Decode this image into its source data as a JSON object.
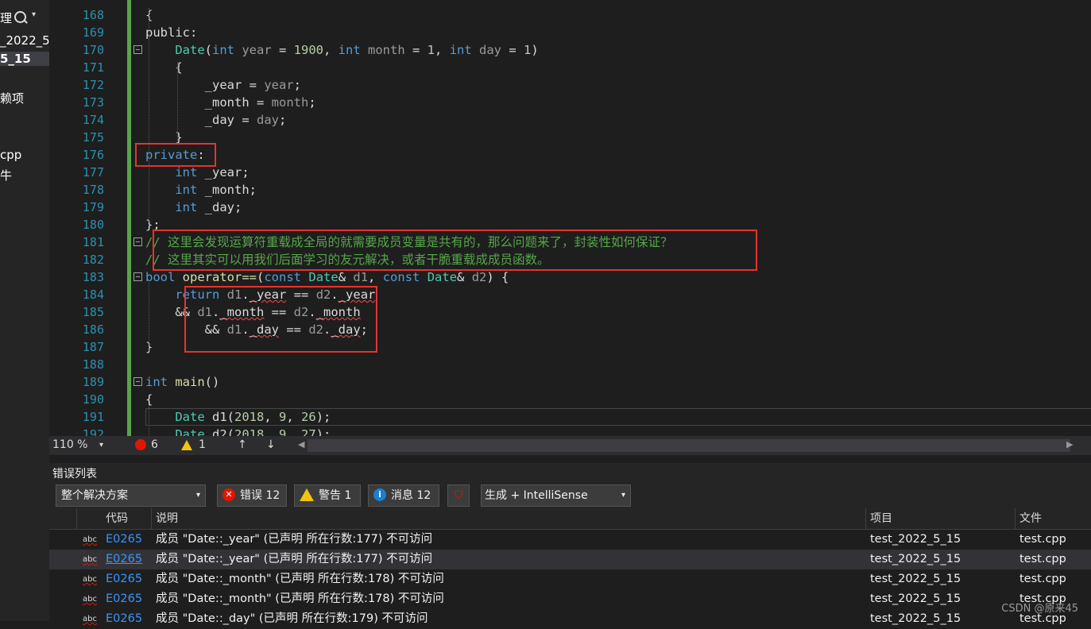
{
  "solution_explorer": {
    "items": [
      "理",
      "_2022_5",
      "5_15",
      "赖项",
      "cpp",
      "牛"
    ]
  },
  "editor": {
    "lines": [
      {
        "n": "168",
        "t": [
          [
            "{",
            ""
          ]
        ]
      },
      {
        "n": "169",
        "t": [
          [
            "public",
            ""
          ],
          [
            ":",
            ""
          ]
        ]
      },
      {
        "n": "170",
        "t": [
          [
            "    ",
            ""
          ],
          [
            "Date",
            "ty"
          ],
          [
            "(",
            ""
          ],
          [
            "int",
            "kw"
          ],
          [
            " year",
            "pa"
          ],
          [
            " = ",
            ""
          ],
          [
            "1900",
            "nm"
          ],
          [
            ", ",
            ""
          ],
          [
            "int",
            "kw"
          ],
          [
            " month",
            "pa"
          ],
          [
            " = ",
            ""
          ],
          [
            "1",
            "nm"
          ],
          [
            ", ",
            ""
          ],
          [
            "int",
            "kw"
          ],
          [
            " day",
            "pa"
          ],
          [
            " = ",
            ""
          ],
          [
            "1",
            "nm"
          ],
          [
            ")",
            ""
          ]
        ]
      },
      {
        "n": "171",
        "t": [
          [
            "    {",
            ""
          ]
        ]
      },
      {
        "n": "172",
        "t": [
          [
            "        _year",
            "me"
          ],
          [
            " = ",
            ""
          ],
          [
            "year",
            "pa"
          ],
          [
            ";",
            ""
          ]
        ]
      },
      {
        "n": "173",
        "t": [
          [
            "        _month",
            "me"
          ],
          [
            " = ",
            ""
          ],
          [
            "month",
            "pa"
          ],
          [
            ";",
            ""
          ]
        ]
      },
      {
        "n": "174",
        "t": [
          [
            "        _day",
            "me"
          ],
          [
            " = ",
            ""
          ],
          [
            "day",
            "pa"
          ],
          [
            ";",
            ""
          ]
        ]
      },
      {
        "n": "175",
        "t": [
          [
            "    }",
            ""
          ]
        ]
      },
      {
        "n": "176",
        "t": [
          [
            "private",
            "kw"
          ],
          [
            ":",
            ""
          ]
        ]
      },
      {
        "n": "177",
        "t": [
          [
            "    ",
            ""
          ],
          [
            "int",
            "kw"
          ],
          [
            " _year",
            "me"
          ],
          [
            ";",
            ""
          ]
        ]
      },
      {
        "n": "178",
        "t": [
          [
            "    ",
            ""
          ],
          [
            "int",
            "kw"
          ],
          [
            " _month",
            "me"
          ],
          [
            ";",
            ""
          ]
        ]
      },
      {
        "n": "179",
        "t": [
          [
            "    ",
            ""
          ],
          [
            "int",
            "kw"
          ],
          [
            " _day",
            "me"
          ],
          [
            ";",
            ""
          ]
        ]
      },
      {
        "n": "180",
        "t": [
          [
            "};",
            ""
          ]
        ]
      },
      {
        "n": "181",
        "t": [
          [
            "// 这里会发现运算符重载成全局的就需要成员变量是共有的，那么问题来了，封装性如何保证？",
            "cm"
          ]
        ]
      },
      {
        "n": "182",
        "t": [
          [
            "// 这里其实可以用我们后面学习的友元解决，或者干脆重载成成员函数。",
            "cm"
          ]
        ]
      },
      {
        "n": "183",
        "t": [
          [
            "bool",
            "kw"
          ],
          [
            " ",
            ""
          ],
          [
            "operator==",
            "fn"
          ],
          [
            "(",
            ""
          ],
          [
            "const",
            "kw"
          ],
          [
            " ",
            ""
          ],
          [
            "Date",
            "ty"
          ],
          [
            "& ",
            ""
          ],
          [
            "d1",
            "pa"
          ],
          [
            ", ",
            ""
          ],
          [
            "const",
            "kw"
          ],
          [
            " ",
            ""
          ],
          [
            "Date",
            "ty"
          ],
          [
            "& ",
            ""
          ],
          [
            "d2",
            "pa"
          ],
          [
            ") {",
            ""
          ]
        ]
      },
      {
        "n": "184",
        "t": [
          [
            "    ",
            ""
          ],
          [
            "return",
            "kw"
          ],
          [
            " ",
            ""
          ],
          [
            "d1",
            "pa"
          ],
          [
            ".",
            ""
          ],
          [
            "_year",
            "sq"
          ],
          [
            " == ",
            ""
          ],
          [
            "d2",
            "pa"
          ],
          [
            ".",
            ""
          ],
          [
            "_year",
            "sq"
          ]
        ]
      },
      {
        "n": "185",
        "t": [
          [
            "    && ",
            ""
          ],
          [
            "d1",
            "pa"
          ],
          [
            ".",
            ""
          ],
          [
            "_month",
            "sq"
          ],
          [
            " == ",
            ""
          ],
          [
            "d2",
            "pa"
          ],
          [
            ".",
            ""
          ],
          [
            "_month",
            "sq"
          ]
        ]
      },
      {
        "n": "186",
        "t": [
          [
            "        && ",
            ""
          ],
          [
            "d1",
            "pa"
          ],
          [
            ".",
            ""
          ],
          [
            "_day",
            "sq"
          ],
          [
            " == ",
            ""
          ],
          [
            "d2",
            "pa"
          ],
          [
            ".",
            ""
          ],
          [
            "_day",
            "sq"
          ],
          [
            ";",
            ""
          ]
        ]
      },
      {
        "n": "187",
        "t": [
          [
            "}",
            ""
          ]
        ]
      },
      {
        "n": "188",
        "t": []
      },
      {
        "n": "189",
        "t": [
          [
            "int",
            "kw"
          ],
          [
            " ",
            ""
          ],
          [
            "main",
            "fn"
          ],
          [
            "()",
            ""
          ]
        ]
      },
      {
        "n": "190",
        "t": [
          [
            "{",
            ""
          ]
        ]
      },
      {
        "n": "191",
        "t": [
          [
            "    ",
            ""
          ],
          [
            "Date",
            "ty"
          ],
          [
            " d1",
            "me"
          ],
          [
            "(",
            ""
          ],
          [
            "2018",
            "nm"
          ],
          [
            ", ",
            ""
          ],
          [
            "9",
            "nm"
          ],
          [
            ", ",
            ""
          ],
          [
            "26",
            "nm"
          ],
          [
            ");",
            ""
          ]
        ]
      },
      {
        "n": "192",
        "t": [
          [
            "    ",
            ""
          ],
          [
            "Date",
            "ty"
          ],
          [
            " d2",
            "me"
          ],
          [
            "(",
            ""
          ],
          [
            "2018",
            "nm"
          ],
          [
            ", ",
            ""
          ],
          [
            "9",
            "nm"
          ],
          [
            ", ",
            ""
          ],
          [
            "27",
            "nm"
          ],
          [
            ");",
            ""
          ]
        ]
      }
    ]
  },
  "status": {
    "zoom": "110 %",
    "errors": "6",
    "warnings": "1",
    "up_arrow": "↑",
    "down_arrow": "↓"
  },
  "error_list": {
    "title": "错误列表",
    "scope": "整个解决方案",
    "errors_btn": "错误 12",
    "warnings_btn": "警告 1",
    "messages_btn": "消息 12",
    "build_filter": "生成 + IntelliSense",
    "columns": {
      "code": "代码",
      "desc": "说明",
      "project": "项目",
      "file": "文件"
    },
    "rows": [
      {
        "code": "E0265",
        "desc": "成员 \"Date::_year\" (已声明 所在行数:177) 不可访问",
        "project": "test_2022_5_15",
        "file": "test.cpp"
      },
      {
        "code": "E0265",
        "desc": "成员 \"Date::_year\" (已声明 所在行数:177) 不可访问",
        "project": "test_2022_5_15",
        "file": "test.cpp"
      },
      {
        "code": "E0265",
        "desc": "成员 \"Date::_month\" (已声明 所在行数:178) 不可访问",
        "project": "test_2022_5_15",
        "file": "test.cpp"
      },
      {
        "code": "E0265",
        "desc": "成员 \"Date::_month\" (已声明 所在行数:178) 不可访问",
        "project": "test_2022_5_15",
        "file": "test.cpp"
      },
      {
        "code": "E0265",
        "desc": "成员 \"Date::_day\" (已声明 所在行数:179) 不可访问",
        "project": "test_2022_5_15",
        "file": "test.cpp"
      }
    ]
  },
  "watermark": "CSDN @原来45"
}
